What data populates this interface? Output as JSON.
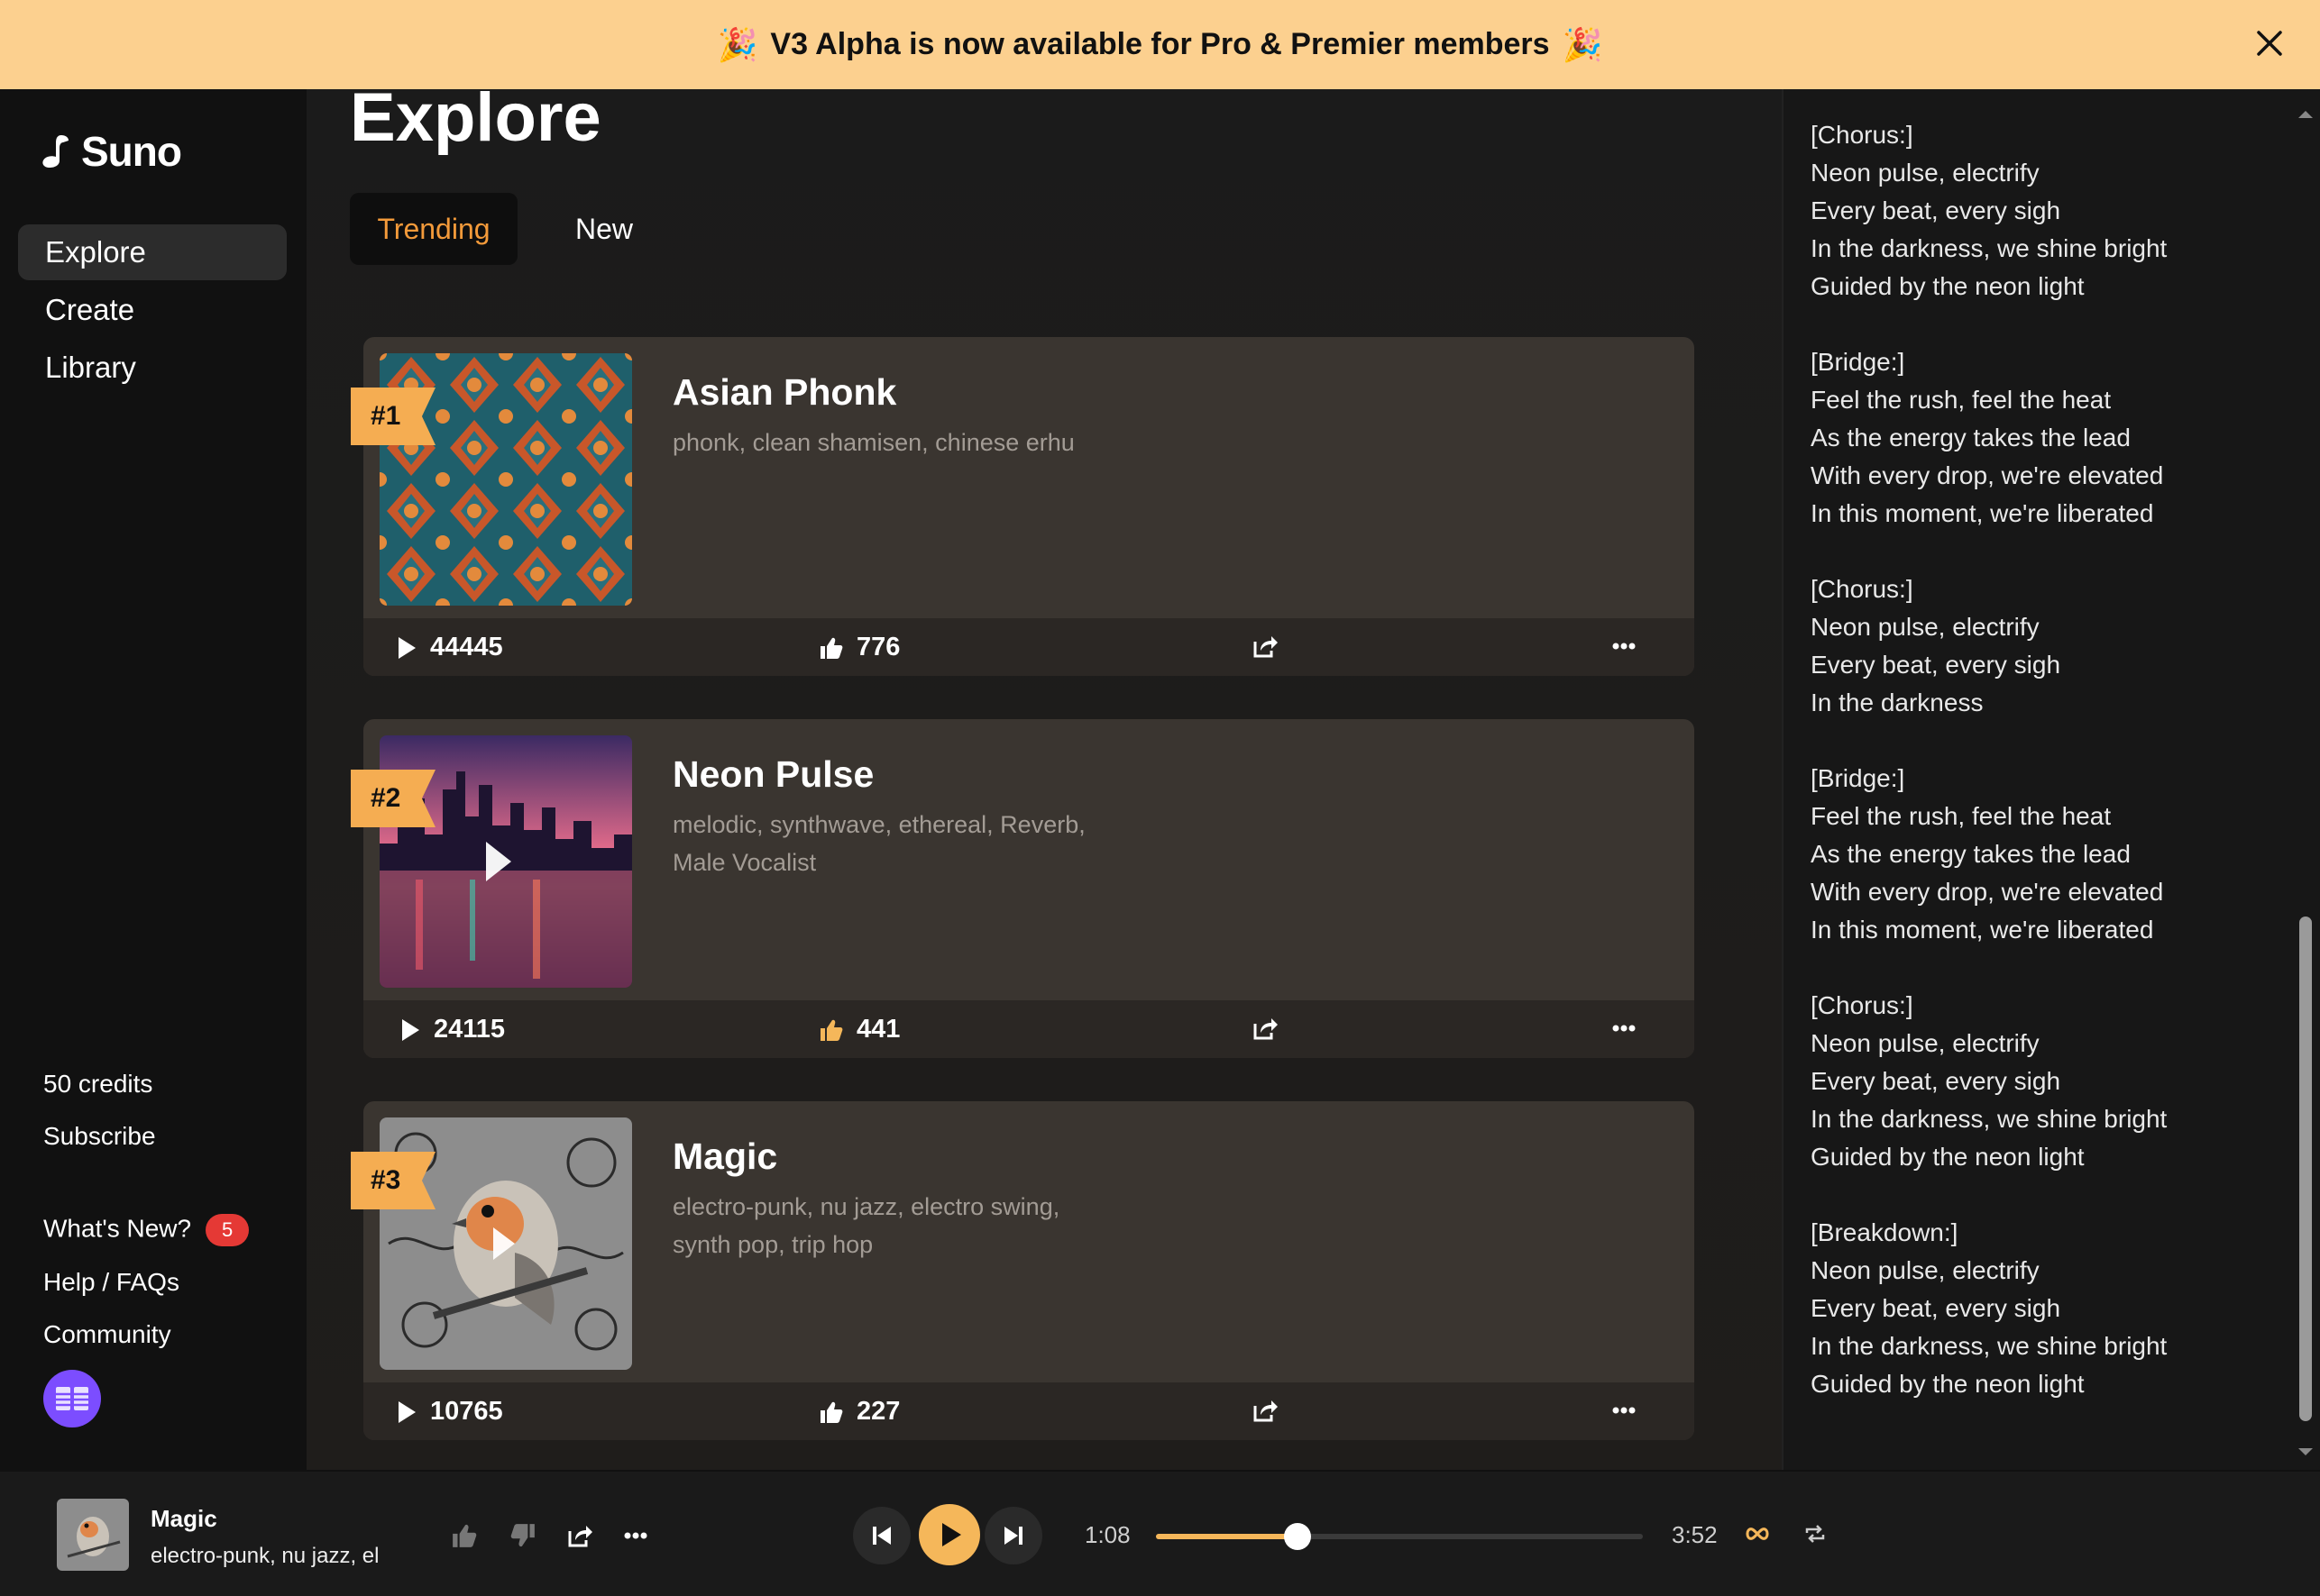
{
  "banner": {
    "text": "V3 Alpha is now available for Pro & Premier members",
    "emoji": "🎉"
  },
  "sidebar": {
    "logo": "Suno",
    "nav": [
      {
        "label": "Explore",
        "active": true
      },
      {
        "label": "Create",
        "active": false
      },
      {
        "label": "Library",
        "active": false
      }
    ],
    "credits": "50 credits",
    "subscribe": "Subscribe",
    "whats_new": "What's New?",
    "whats_new_count": "5",
    "help": "Help / FAQs",
    "community": "Community"
  },
  "main": {
    "title": "Explore",
    "tabs": [
      {
        "label": "Trending",
        "active": true
      },
      {
        "label": "New",
        "active": false
      }
    ],
    "cards": [
      {
        "rank": "#1",
        "title": "Asian Phonk",
        "tags": "phonk, clean shamisen, chinese erhu",
        "plays": "44445",
        "likes": "776"
      },
      {
        "rank": "#2",
        "title": "Neon Pulse",
        "tags": "melodic, synthwave, ethereal, Reverb, Male Vocalist",
        "plays": "24115",
        "likes": "441"
      },
      {
        "rank": "#3",
        "title": "Magic",
        "tags": "electro-punk, nu jazz, electro swing, synth pop, trip hop",
        "plays": "10765",
        "likes": "227"
      }
    ]
  },
  "lyrics": "[Chorus:]\nNeon pulse, electrify\nEvery beat, every sigh\nIn the darkness, we shine bright\nGuided by the neon light\n\n[Bridge:]\nFeel the rush, feel the heat\nAs the energy takes the lead\nWith every drop, we're elevated\nIn this moment, we're liberated\n\n[Chorus:]\nNeon pulse, electrify\nEvery beat, every sigh\nIn the darkness\n\n[Bridge:]\nFeel the rush, feel the heat\nAs the energy takes the lead\nWith every drop, we're elevated\nIn this moment, we're liberated\n\n[Chorus:]\nNeon pulse, electrify\nEvery beat, every sigh\nIn the darkness, we shine bright\nGuided by the neon light\n\n[Breakdown:]\nNeon pulse, electrify\nEvery beat, every sigh\nIn the darkness, we shine bright\nGuided by the neon light",
  "player": {
    "title": "Magic",
    "tags": "electro-punk, nu jazz, el",
    "current_time": "1:08",
    "total_time": "3:52",
    "progress": 0.29
  },
  "colors": {
    "accent": "#f5b75a",
    "banner": "#fcd08f",
    "rank": "#f5ad52",
    "tab_active": "#f39a3a",
    "badge": "#e53935"
  },
  "icons": [
    "close-icon",
    "party-popper-icon",
    "suno-logo-icon",
    "play-icon",
    "thumbs-up-icon",
    "thumbs-down-icon",
    "share-icon",
    "more-icon",
    "previous-icon",
    "next-icon",
    "infinity-icon",
    "repeat-icon"
  ]
}
